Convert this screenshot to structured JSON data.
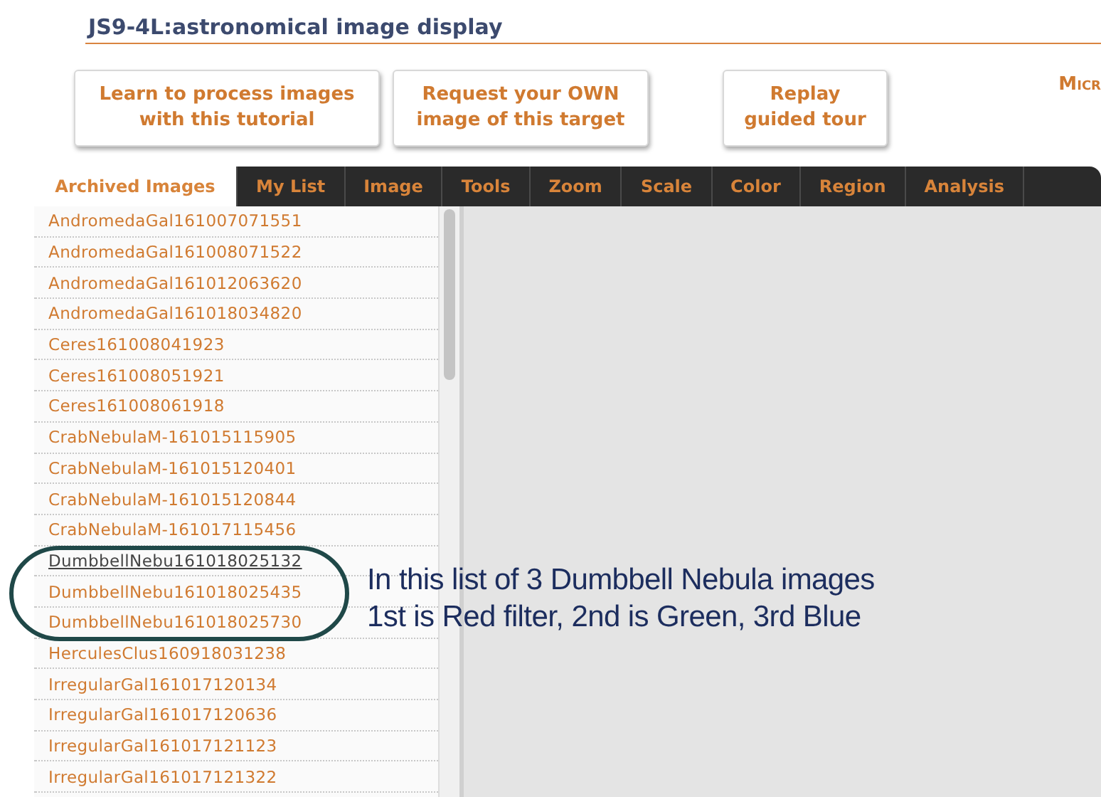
{
  "header": {
    "title": "JS9-4L:astronomical image display"
  },
  "buttons": [
    "Learn to process images with this tutorial",
    "Request your OWN image of this target",
    "Replay guided tour"
  ],
  "cut_link": "Micr",
  "tabs": [
    {
      "label": "Archived Images",
      "selected": true
    },
    {
      "label": "My List",
      "selected": false
    },
    {
      "label": "Image",
      "selected": false
    },
    {
      "label": "Tools",
      "selected": false
    },
    {
      "label": "Zoom",
      "selected": false
    },
    {
      "label": "Scale",
      "selected": false
    },
    {
      "label": "Color",
      "selected": false
    },
    {
      "label": "Region",
      "selected": false
    },
    {
      "label": "Analysis",
      "selected": false
    }
  ],
  "images": [
    {
      "name": "AndromedaGal161007071551",
      "selected": false
    },
    {
      "name": "AndromedaGal161008071522",
      "selected": false
    },
    {
      "name": "AndromedaGal161012063620",
      "selected": false
    },
    {
      "name": "AndromedaGal161018034820",
      "selected": false
    },
    {
      "name": "Ceres161008041923",
      "selected": false
    },
    {
      "name": "Ceres161008051921",
      "selected": false
    },
    {
      "name": "Ceres161008061918",
      "selected": false
    },
    {
      "name": "CrabNebulaM-161015115905",
      "selected": false
    },
    {
      "name": "CrabNebulaM-161015120401",
      "selected": false
    },
    {
      "name": "CrabNebulaM-161015120844",
      "selected": false
    },
    {
      "name": "CrabNebulaM-161017115456",
      "selected": false
    },
    {
      "name": "DumbbellNebu161018025132",
      "selected": true
    },
    {
      "name": "DumbbellNebu161018025435",
      "selected": false
    },
    {
      "name": "DumbbellNebu161018025730",
      "selected": false
    },
    {
      "name": "HerculesClus160918031238",
      "selected": false
    },
    {
      "name": "IrregularGal161017120134",
      "selected": false
    },
    {
      "name": "IrregularGal161017120636",
      "selected": false
    },
    {
      "name": "IrregularGal161017121123",
      "selected": false
    },
    {
      "name": "IrregularGal161017121322",
      "selected": false
    }
  ],
  "annotation": [
    "In this list of 3 Dumbbell Nebula images",
    "1st is Red filter, 2nd is Green, 3rd Blue"
  ]
}
